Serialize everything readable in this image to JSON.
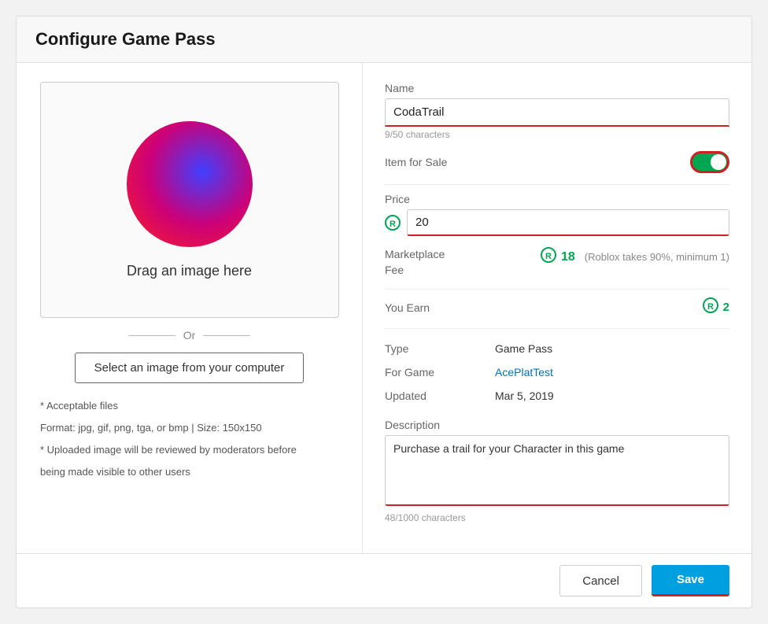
{
  "header": {
    "title": "Configure Game Pass"
  },
  "left": {
    "drag_text": "Drag an image here",
    "or_text": "Or",
    "select_button_label": "Select an image from your computer",
    "file_info_line1": "* Acceptable files",
    "file_info_line2": "Format: jpg, gif, png, tga, or bmp | Size: 150x150",
    "file_info_line3": "* Uploaded image will be reviewed by moderators before",
    "file_info_line4": "being made visible to other users"
  },
  "form": {
    "name_label": "Name",
    "name_value": "CodaTrail",
    "name_char_count": "9/50 characters",
    "item_for_sale_label": "Item for Sale",
    "price_label": "Price",
    "price_value": "20",
    "marketplace_fee_label": "Marketplace Fee",
    "marketplace_fee_value": "18",
    "marketplace_note": "(Roblox takes 90%, minimum 1)",
    "you_earn_label": "You Earn",
    "you_earn_value": "2",
    "type_label": "Type",
    "type_value": "Game Pass",
    "for_game_label": "For Game",
    "for_game_value": "AcePlatTest",
    "updated_label": "Updated",
    "updated_value": "Mar 5, 2019",
    "description_label": "Description",
    "description_value": "Purchase a trail for your Character in this game",
    "description_char_count": "48/1000 characters"
  },
  "footer": {
    "cancel_label": "Cancel",
    "save_label": "Save"
  },
  "icons": {
    "robux": "®"
  }
}
